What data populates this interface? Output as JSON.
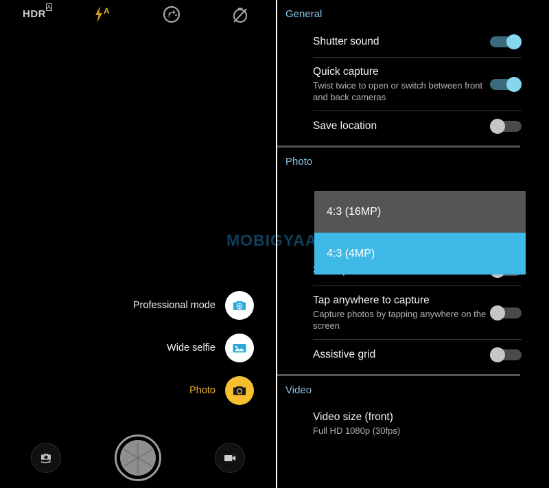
{
  "camera": {
    "top_icons": [
      {
        "name": "hdr-auto-icon",
        "label": "HDR",
        "sup": "A"
      },
      {
        "name": "flash-auto-icon",
        "label": "A"
      },
      {
        "name": "beautify-icon",
        "label": ""
      },
      {
        "name": "timer-off-icon",
        "label": ""
      }
    ],
    "modes": [
      {
        "label": "Professional mode",
        "icon": "professional-camera-icon",
        "active": false
      },
      {
        "label": "Wide selfie",
        "icon": "wide-selfie-icon",
        "active": false
      },
      {
        "label": "Photo",
        "icon": "photo-camera-icon",
        "active": true
      }
    ],
    "bottom_bar": {
      "switch_camera": "switch-camera-icon",
      "shutter": "shutter-button",
      "video": "video-camera-icon"
    },
    "watermark": "MOBIGYAAN"
  },
  "settings": {
    "sections": [
      {
        "title": "General"
      },
      {
        "title": "Photo"
      },
      {
        "title": "Video"
      }
    ],
    "general": {
      "title": "General",
      "rows": [
        {
          "title": "Shutter sound",
          "sub": "",
          "toggle": "on"
        },
        {
          "title": "Quick capture",
          "sub": "Twist twice to open or switch between front and back cameras",
          "toggle": "on"
        },
        {
          "title": "Save location",
          "sub": "",
          "toggle": "off"
        }
      ]
    },
    "photo": {
      "title": "Photo",
      "rows": [
        {
          "title": "Selfie photo mirror",
          "sub": "",
          "toggle": "off"
        },
        {
          "title": "Tap anywhere to capture",
          "sub": "Capture photos by tapping anywhere on the screen",
          "toggle": "off"
        },
        {
          "title": "Assistive grid",
          "sub": "",
          "toggle": "off"
        }
      ]
    },
    "video": {
      "title": "Video",
      "rows": [
        {
          "title": "Video size (front)",
          "sub": "Full HD 1080p (30fps)"
        }
      ]
    },
    "dropdown": {
      "options": [
        {
          "label": "4:3 (16MP)",
          "selected": false
        },
        {
          "label": "4:3 (4MP)",
          "selected": true
        }
      ]
    }
  },
  "colors": {
    "accent_blue": "#3fb9e5",
    "section_header": "#8bc6e8",
    "active_mode": "#f4c02e",
    "toggle_on_thumb": "#86d6ef",
    "toggle_on_track": "#3b6b7a",
    "toggle_off_thumb": "#c6c6c6",
    "toggle_off_track": "#4a4a4a"
  }
}
